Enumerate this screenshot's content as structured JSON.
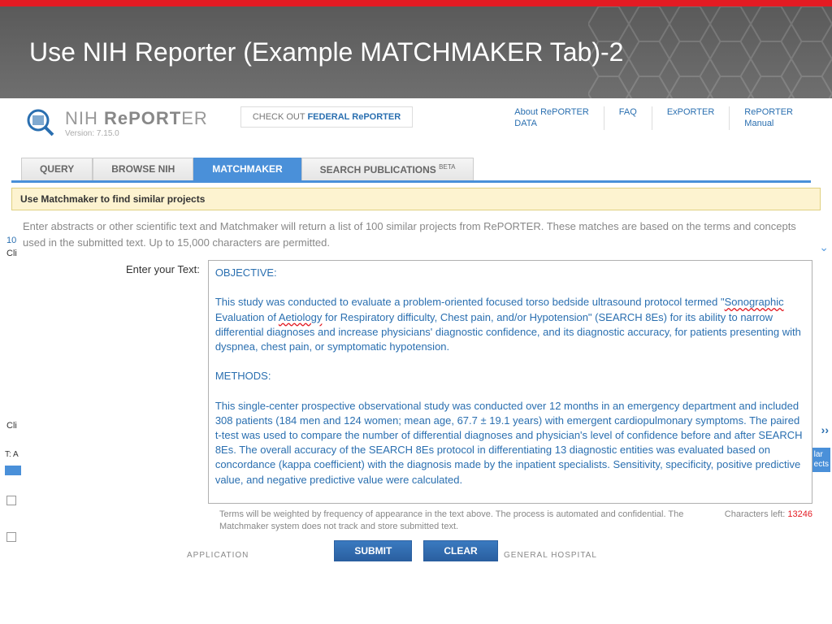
{
  "slide_title": "Use NIH Reporter (Example MATCHMAKER Tab)-2",
  "logo": {
    "name_part1": "NIH ",
    "name_part2": "RePORT",
    "name_part3": "ER",
    "version": "Version: 7.15.0"
  },
  "check_out": {
    "prefix": "CHECK OUT ",
    "link": "FEDERAL RePORTER"
  },
  "nav_links": [
    {
      "label": "About RePORTER\nDATA"
    },
    {
      "label": "FAQ"
    },
    {
      "label": "ExPORTER"
    },
    {
      "label": "RePORTER\nManual"
    }
  ],
  "tabs": [
    {
      "label": "QUERY",
      "active": false
    },
    {
      "label": "BROWSE NIH",
      "active": false
    },
    {
      "label": "MATCHMAKER",
      "active": true
    },
    {
      "label": "SEARCH PUBLICATIONS",
      "active": false,
      "beta": "BETA"
    }
  ],
  "banner": "Use Matchmaker to find similar projects",
  "instructions": "Enter abstracts or other scientific text and Matchmaker will return a list of 100 similar projects from RePORTER. These matches are based on the terms and concepts used in the submitted text. Up to 15,000 characters are permitted.",
  "form_label": "Enter your Text:",
  "textarea_content": {
    "objective_label": "OBJECTIVE:",
    "objective_body_pre": "This study was conducted to evaluate a problem-oriented focused torso bedside ultrasound protocol termed \"",
    "spell1": "Sonographic",
    "objective_mid1": " Evaluation of ",
    "spell2": "Aetiology",
    "objective_body_post": " for Respiratory difficulty, Chest pain, and/or Hypotension\" (SEARCH 8Es) for its ability to narrow differential diagnoses and increase physicians' diagnostic confidence, and its diagnostic accuracy, for patients presenting with dyspnea, chest pain, or symptomatic hypotension.",
    "methods_label": "METHODS:",
    "methods_body": "This single-center prospective observational study was conducted over 12 months in an emergency department and included 308 patients (184 men and 124 women; mean age, 67.7 ± 19.1 years) with emergent cardiopulmonary symptoms. The paired t-test was used to compare the number of differential diagnoses and physician's level of confidence before and after SEARCH 8Es. The overall accuracy of the SEARCH 8Es protocol in differentiating 13 diagnostic entities was evaluated based on concordance (kappa coefficient) with the diagnosis made by the inpatient specialists. Sensitivity, specificity, positive predictive value, and negative predictive value were calculated."
  },
  "footer": {
    "note": "Terms will be weighted by frequency of appearance in the text above. The process is automated and confidential. The Matchmaker system does not track and store submitted text.",
    "chars_label": "Characters left: ",
    "chars_count": "13246"
  },
  "buttons": {
    "submit": "SUBMIT",
    "clear": "CLEAR"
  },
  "fragments": {
    "left1": "10",
    "left2": "Cli",
    "left3": "Cli",
    "left4": "T: A",
    "bottom1": "APPLICATION",
    "bottom2": "GENERAL HOSPITAL",
    "right_lar": "lar",
    "right_ects": "ects"
  }
}
